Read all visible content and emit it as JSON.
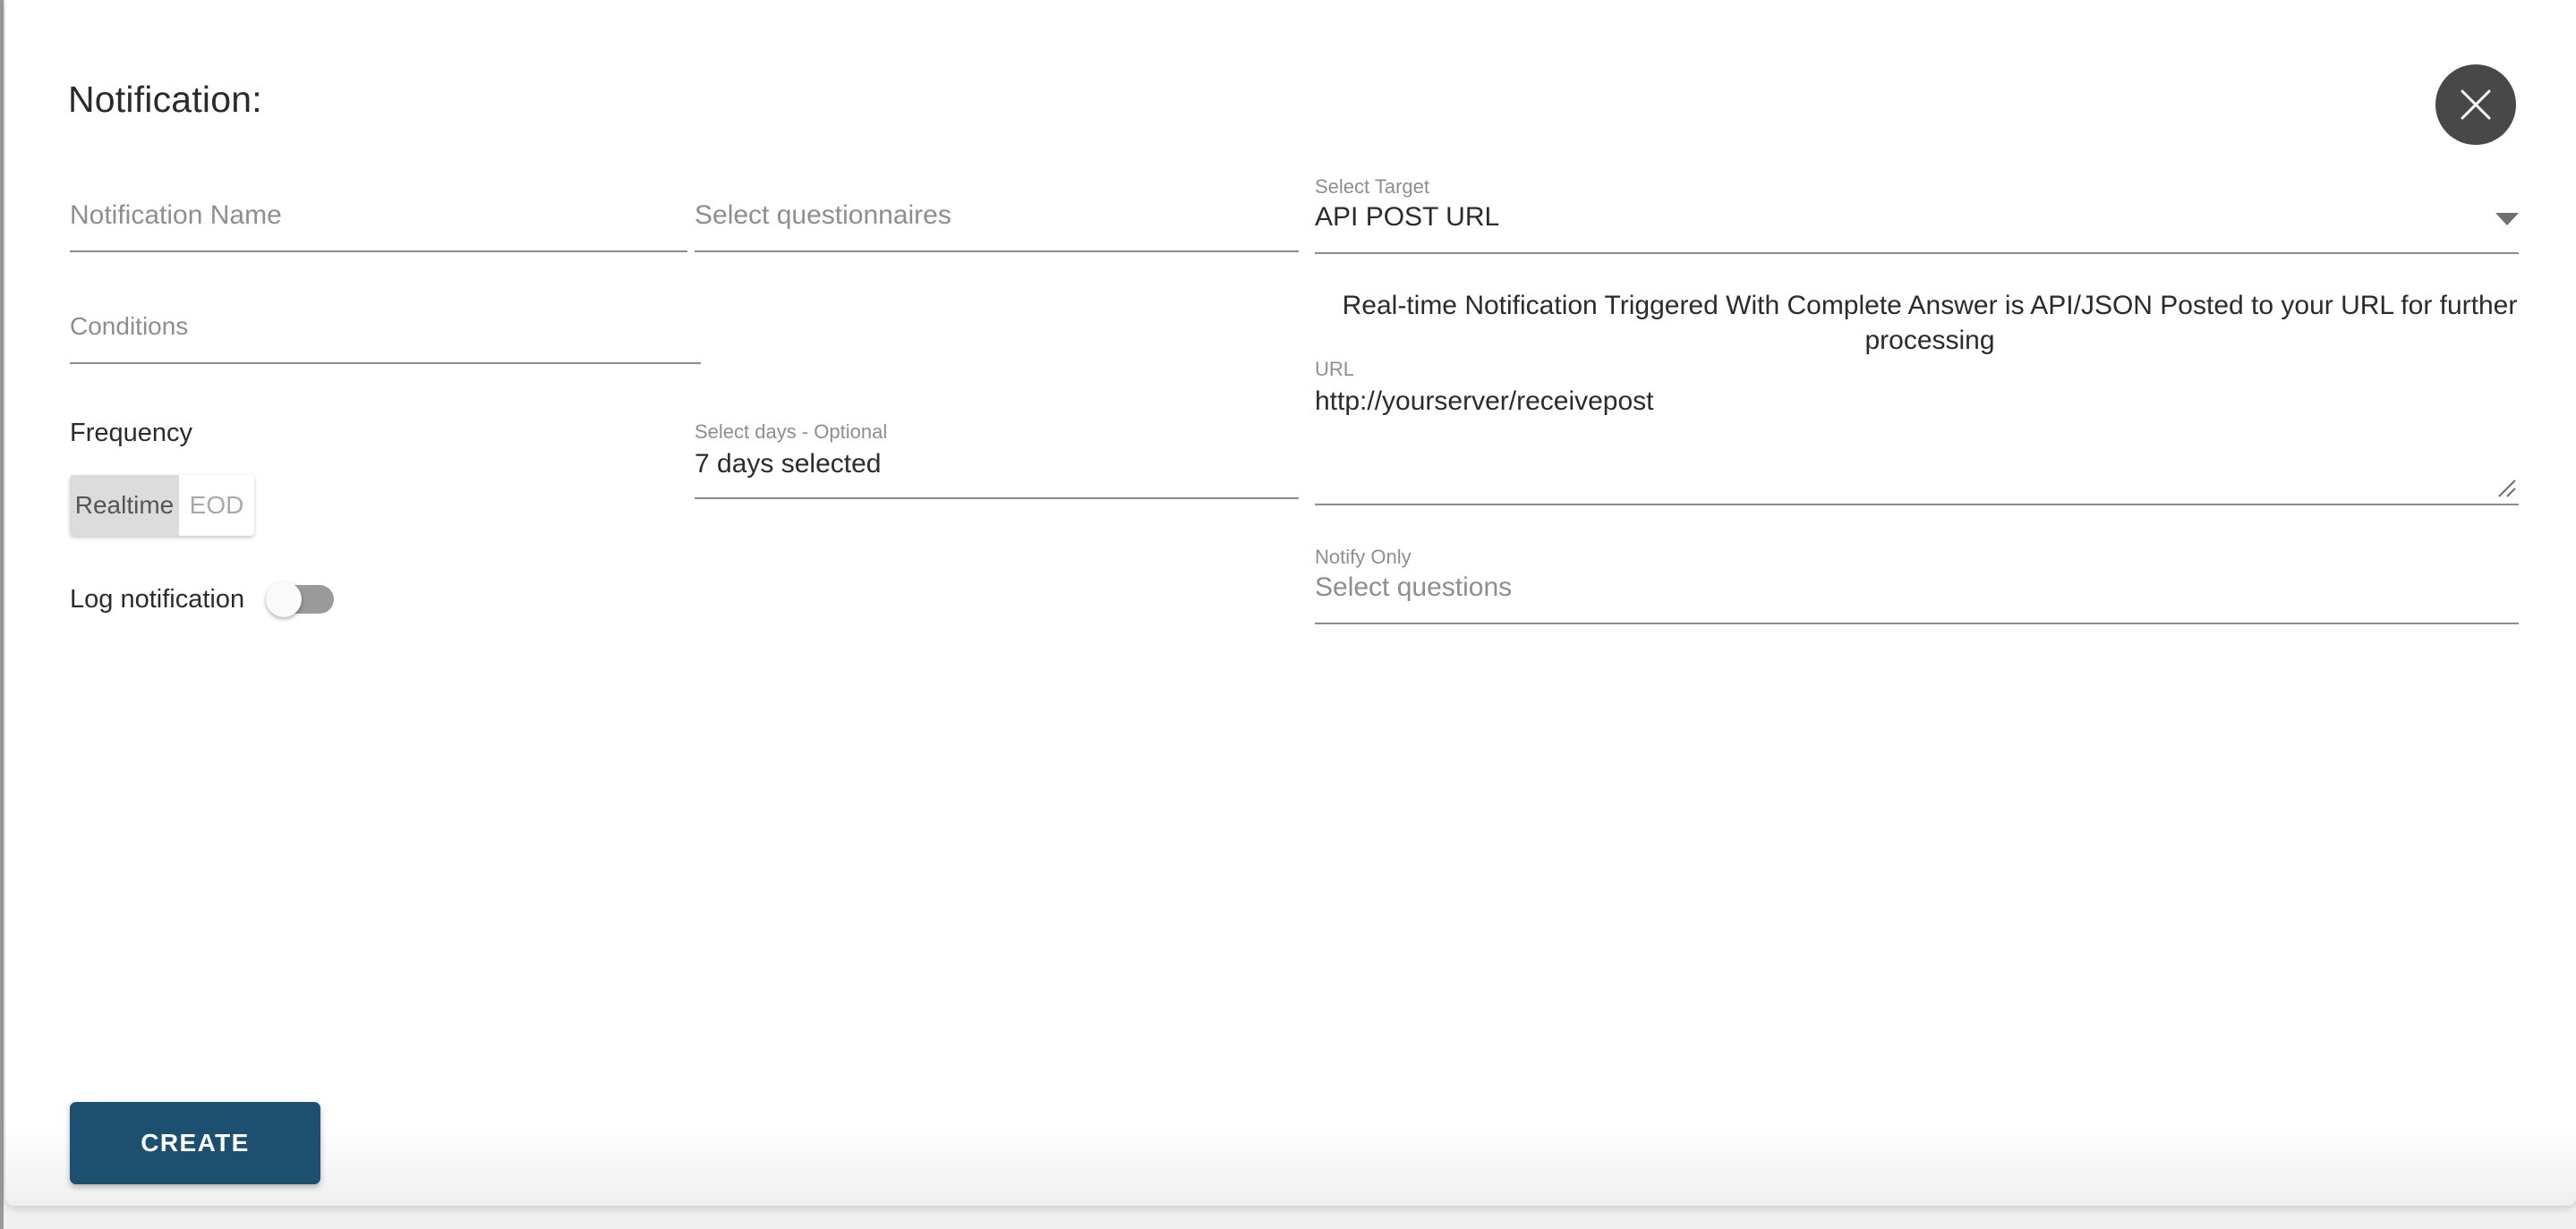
{
  "dialog": {
    "title": "Notification:",
    "close_icon": "close-icon"
  },
  "left_column": {
    "notification_name": {
      "placeholder": "Notification Name",
      "value": ""
    },
    "conditions": {
      "placeholder": "Conditions",
      "value": ""
    },
    "frequency": {
      "heading": "Frequency",
      "options": [
        {
          "label": "Realtime",
          "selected": true
        },
        {
          "label": "EOD",
          "selected": false
        }
      ]
    },
    "log_notification": {
      "label": "Log notification",
      "state": "off"
    }
  },
  "middle_column": {
    "questionnaires": {
      "placeholder": "Select questionnaires",
      "value": ""
    },
    "select_days": {
      "label": "Select days - Optional",
      "value": "7 days selected"
    }
  },
  "right_column": {
    "select_target": {
      "label": "Select Target",
      "value": "API POST URL",
      "caret_icon": "chevron-down-icon"
    },
    "target_description": "Real-time Notification Triggered With Complete Answer is API/JSON Posted to your URL for further processing",
    "url": {
      "label": "URL",
      "value": "http://yourserver/receivepost",
      "resize_icon": "resize-grip-icon"
    },
    "notify_only": {
      "label": "Notify Only",
      "placeholder": "Select questions",
      "value": ""
    }
  },
  "footer": {
    "create_label": "CREATE"
  },
  "colors": {
    "primary": "#1d4f70",
    "close_button": "#484848",
    "field_underline": "#8c8c8c",
    "muted_text": "#8e8e8e",
    "body_text": "#2b2b2b",
    "segment_selected_bg": "#dcdcdc",
    "switch_track": "#9a9a9a"
  }
}
